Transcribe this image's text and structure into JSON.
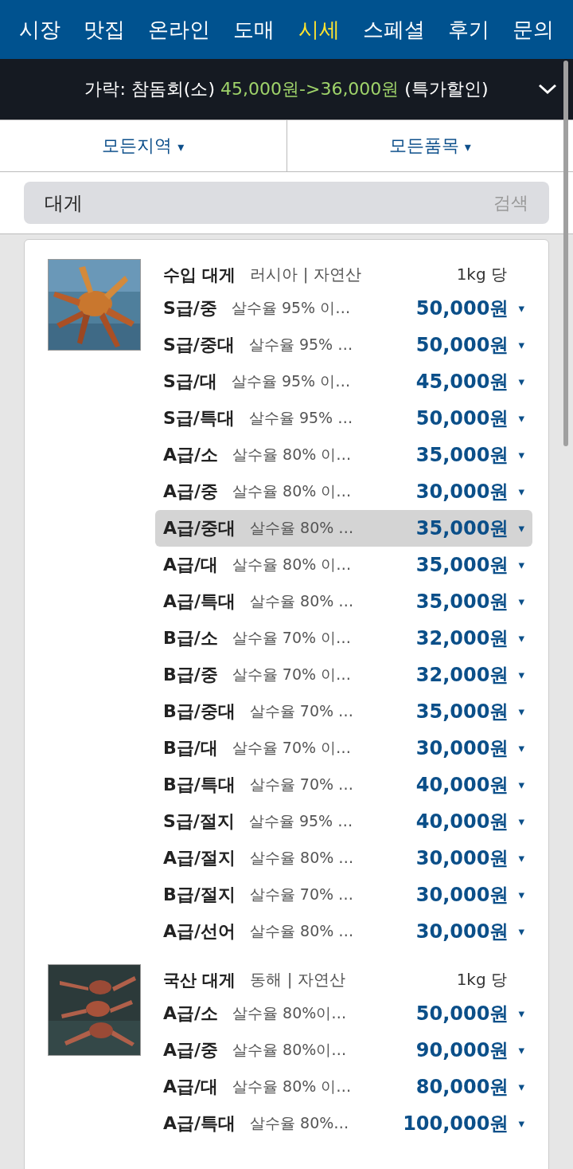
{
  "nav": [
    {
      "label": "시장",
      "selected": false
    },
    {
      "label": "맛집",
      "selected": false
    },
    {
      "label": "온라인",
      "selected": false
    },
    {
      "label": "도매",
      "selected": false
    },
    {
      "label": "시세",
      "selected": true
    },
    {
      "label": "스페셜",
      "selected": false
    },
    {
      "label": "후기",
      "selected": false
    },
    {
      "label": "문의",
      "selected": false
    }
  ],
  "notice": {
    "prefix": "가락: 참돔회(소)",
    "price": "45,000원->36,000원",
    "suffix": "(특가할인)"
  },
  "filters": [
    {
      "label": "모든지역",
      "caret": "▾"
    },
    {
      "label": "모든품목",
      "caret": "▾"
    }
  ],
  "search": {
    "value": "대게",
    "button": "검색"
  },
  "sections": [
    {
      "title": "수입 대게",
      "origin": "러시아 | 자연산",
      "unit": "1kg 당",
      "rows": [
        {
          "grade": "S급/중",
          "desc": "살수율 95% 이…",
          "price": "50,000원",
          "selected": false
        },
        {
          "grade": "S급/중대",
          "desc": "살수율 95% …",
          "price": "50,000원",
          "selected": false
        },
        {
          "grade": "S급/대",
          "desc": "살수율 95% 이…",
          "price": "45,000원",
          "selected": false
        },
        {
          "grade": "S급/특대",
          "desc": "살수율 95% …",
          "price": "50,000원",
          "selected": false
        },
        {
          "grade": "A급/소",
          "desc": "살수율 80% 이…",
          "price": "35,000원",
          "selected": false
        },
        {
          "grade": "A급/중",
          "desc": "살수율 80% 이…",
          "price": "30,000원",
          "selected": false
        },
        {
          "grade": "A급/중대",
          "desc": "살수율 80% …",
          "price": "35,000원",
          "selected": true
        },
        {
          "grade": "A급/대",
          "desc": "살수율 80% 이…",
          "price": "35,000원",
          "selected": false
        },
        {
          "grade": "A급/특대",
          "desc": "살수율 80% …",
          "price": "35,000원",
          "selected": false
        },
        {
          "grade": "B급/소",
          "desc": "살수율 70% 이…",
          "price": "32,000원",
          "selected": false
        },
        {
          "grade": "B급/중",
          "desc": "살수율 70% 이…",
          "price": "32,000원",
          "selected": false
        },
        {
          "grade": "B급/중대",
          "desc": "살수율 70% …",
          "price": "35,000원",
          "selected": false
        },
        {
          "grade": "B급/대",
          "desc": "살수율 70% 이…",
          "price": "30,000원",
          "selected": false
        },
        {
          "grade": "B급/특대",
          "desc": "살수율 70% …",
          "price": "40,000원",
          "selected": false
        },
        {
          "grade": "S급/절지",
          "desc": "살수율 95% …",
          "price": "40,000원",
          "selected": false
        },
        {
          "grade": "A급/절지",
          "desc": "살수율 80% …",
          "price": "30,000원",
          "selected": false
        },
        {
          "grade": "B급/절지",
          "desc": "살수율 70% …",
          "price": "30,000원",
          "selected": false
        },
        {
          "grade": "A급/선어",
          "desc": "살수율 80% …",
          "price": "30,000원",
          "selected": false
        }
      ]
    },
    {
      "title": "국산 대게",
      "origin": "동해 | 자연산",
      "unit": "1kg 당",
      "rows": [
        {
          "grade": "A급/소",
          "desc": "살수율 80%이…",
          "price": "50,000원",
          "selected": false
        },
        {
          "grade": "A급/중",
          "desc": "살수율 80%이…",
          "price": "90,000원",
          "selected": false
        },
        {
          "grade": "A급/대",
          "desc": "살수율 80% 이…",
          "price": "80,000원",
          "selected": false
        },
        {
          "grade": "A급/특대",
          "desc": "살수율 80%…",
          "price": "100,000원",
          "selected": false
        }
      ]
    }
  ],
  "caret": "▾"
}
